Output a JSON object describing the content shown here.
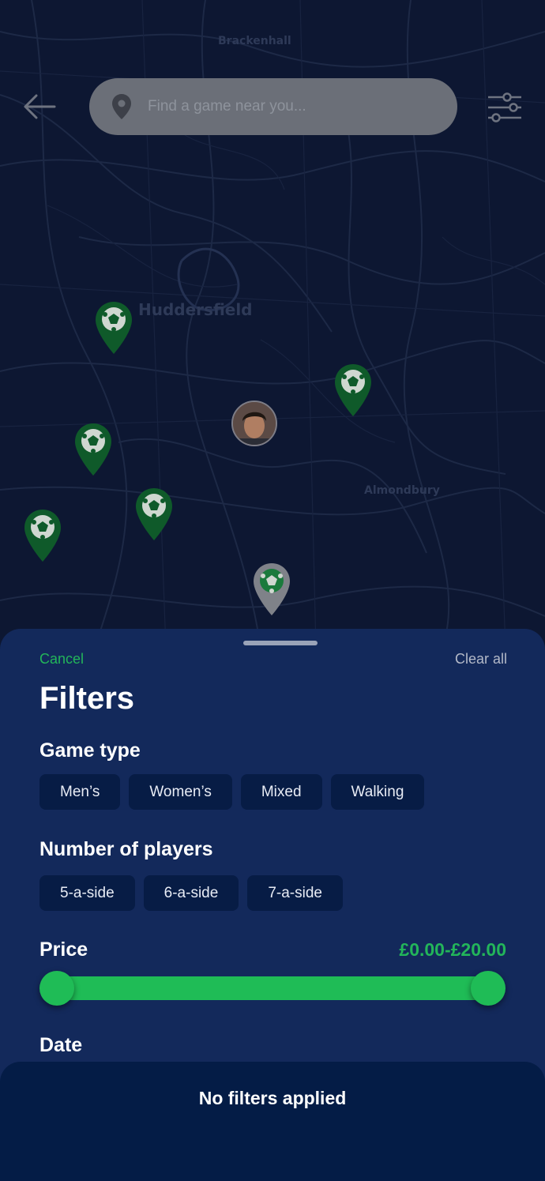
{
  "colors": {
    "accent": "#1fbc56",
    "sheet_bg": "#13295b",
    "chip_bg": "#071c45",
    "map_bg": "#0d1732",
    "pin_green": "#0f5a2a",
    "pin_grey": "#7f8289"
  },
  "map": {
    "places": [
      "Brackenhall",
      "Huddersfield",
      "Almondbury"
    ],
    "search": {
      "placeholder": "Find a game near you..."
    }
  },
  "filters": {
    "cancel_label": "Cancel",
    "clear_all_label": "Clear all",
    "title": "Filters",
    "game_type": {
      "title": "Game type",
      "options": [
        "Men’s",
        "Women’s",
        "Mixed",
        "Walking"
      ]
    },
    "players": {
      "title": "Number of players",
      "options": [
        "5-a-side",
        "6-a-side",
        "7-a-side"
      ]
    },
    "price": {
      "title": "Price",
      "range_text": "£0.00-£20.00",
      "min": 0,
      "max": 20,
      "selected_min": 0,
      "selected_max": 20
    },
    "date": {
      "title": "Date"
    }
  },
  "status": {
    "text": "No filters applied"
  },
  "icons": [
    "back-arrow-icon",
    "location-pin-icon",
    "filter-sliders-icon",
    "football-pin-icon",
    "user-avatar"
  ]
}
